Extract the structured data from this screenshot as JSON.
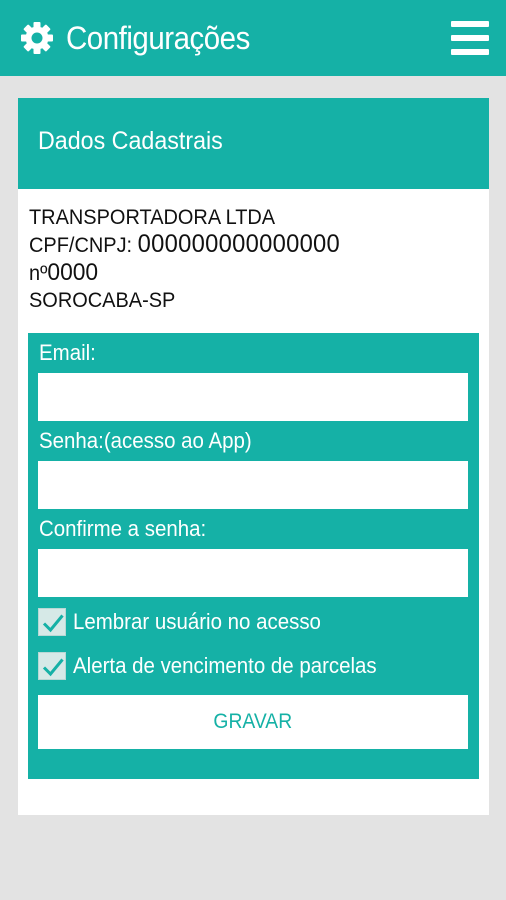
{
  "colors": {
    "primary": "#15b1a6",
    "background": "#e3e3e3",
    "card": "#ffffff"
  },
  "appbar": {
    "title": "Configurações",
    "left_icon": "gear-icon",
    "right_icon": "hamburger-menu-icon"
  },
  "section": {
    "title": "Dados Cadastrais"
  },
  "company": {
    "name": "TRANSPORTADORA LTDA",
    "cnpj_label": "CPF/CNPJ:",
    "cnpj_value": "000000000000000",
    "number_prefix": "nº",
    "number_value": "0000",
    "city": "SOROCABA-SP"
  },
  "form": {
    "email_label": "Email:",
    "email_value": "",
    "password_label": "Senha:(acesso ao App)",
    "password_value": "",
    "confirm_label": "Confirme a senha:",
    "confirm_value": "",
    "remember": {
      "label": "Lembrar usuário no acesso",
      "checked": true
    },
    "alert": {
      "label": "Alerta de vencimento de parcelas",
      "checked": true
    },
    "save_label": "GRAVAR"
  }
}
